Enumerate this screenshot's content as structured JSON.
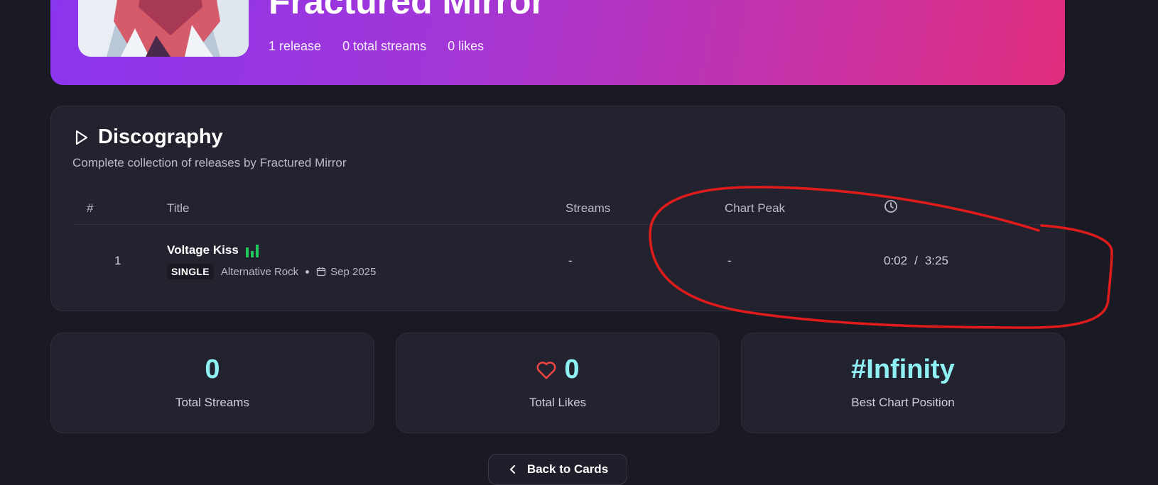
{
  "artist": {
    "name": "Fractured Mirror",
    "stats": [
      "1 release",
      "0 total streams",
      "0 likes"
    ]
  },
  "discography": {
    "title": "Discography",
    "subtitle": "Complete collection of releases by Fractured Mirror",
    "columns": {
      "num": "#",
      "title": "Title",
      "streams": "Streams",
      "chart_peak": "Chart Peak",
      "duration_icon": "clock-icon"
    },
    "tracks": [
      {
        "num": "1",
        "title": "Voltage Kiss",
        "type": "SINGLE",
        "genre": "Alternative Rock",
        "date": "Sep 2025",
        "streams": "-",
        "chart_peak": "-",
        "position": "0:02",
        "separator": "/",
        "duration": "3:25"
      }
    ]
  },
  "stats": {
    "total_streams": {
      "value": "0",
      "label": "Total Streams"
    },
    "total_likes": {
      "value": "0",
      "label": "Total Likes"
    },
    "best_chart": {
      "value": "#Infinity",
      "label": "Best Chart Position"
    }
  },
  "back_button": {
    "label": "Back to Cards"
  },
  "colors": {
    "accent_cyan": "#8ff1f4",
    "playing_green": "#22c55e",
    "heart_red": "#ef4444",
    "annotation_red": "#e01b1b"
  }
}
